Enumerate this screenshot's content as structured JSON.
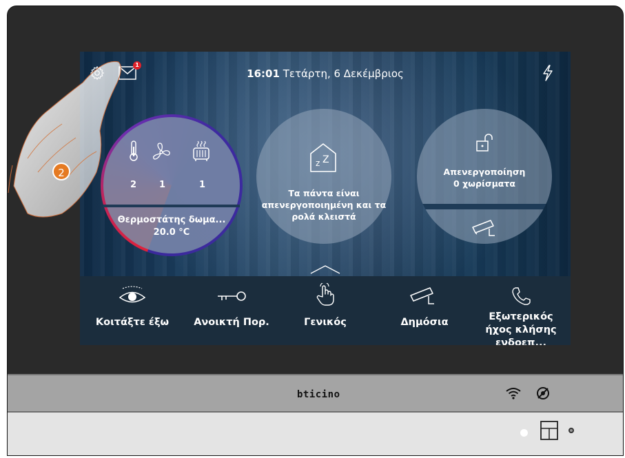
{
  "status_bar": {
    "time": "16:01",
    "date": "Τετάρτη, 6 Δεκέμβριος",
    "unread_count": "1"
  },
  "thermostat_tile": {
    "counts": [
      "2",
      "1",
      "1"
    ],
    "icons": [
      "thermometer-icon",
      "fan-icon",
      "radiator-icon"
    ],
    "name": "Θερμοστάτης δωμα...",
    "temperature": "20.0 °C",
    "ring_colors": [
      "#e0223a",
      "#3b2a9c"
    ]
  },
  "scenario_tile": {
    "icon": "house-sleep-icon",
    "text": "Τα πάντα είναι απενεργοποιημένη και τα ρολά κλειστά"
  },
  "alarm_tile": {
    "icon": "unlocked-padlock-icon",
    "line1": "Απενεργοποίηση",
    "line2": "0 χωρίσματα",
    "camera_icon": "camera-icon"
  },
  "actions": [
    {
      "icon": "eye-icon",
      "label": "Κοιτάξτε έξω"
    },
    {
      "icon": "key-icon",
      "label": "Ανοικτή Πορ."
    },
    {
      "icon": "touch-icon",
      "label": "Γενικός"
    },
    {
      "icon": "camera-icon",
      "label": "Δημόσια"
    },
    {
      "icon": "phone-icon",
      "label": "Εξωτερικός ήχος κλήσης ενδοεπ..."
    }
  ],
  "frame": {
    "brand": "bticino"
  },
  "overlay": {
    "step_number": "2"
  }
}
